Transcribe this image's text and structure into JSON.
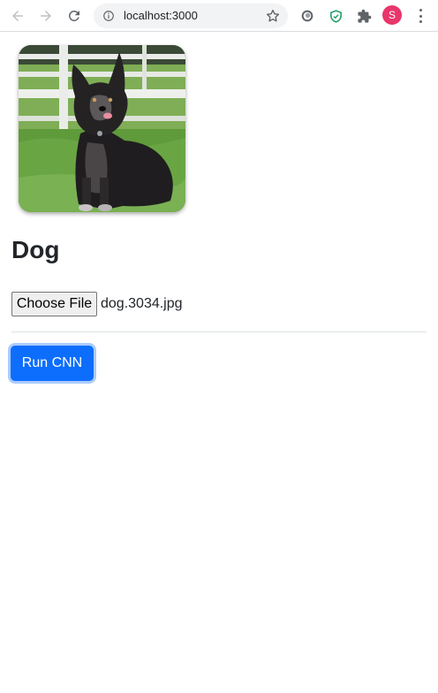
{
  "browser": {
    "url": "localhost:3000",
    "profile_initial": "S",
    "profile_color": "#e8366a"
  },
  "page": {
    "image_alt": "dog photo",
    "title": "Dog",
    "choose_file_label": "Choose File",
    "file_name": "dog.3034.jpg",
    "run_button_label": "Run CNN",
    "accent_color": "#0d6efd"
  }
}
